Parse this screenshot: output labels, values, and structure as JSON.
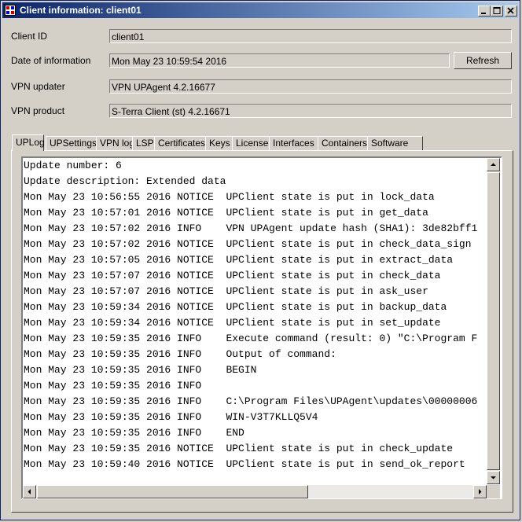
{
  "window": {
    "title": "Client information: client01"
  },
  "fields": [
    {
      "label": "Client ID",
      "value": "client01"
    },
    {
      "label": "Date of information",
      "value": "Mon May 23 10:59:54 2016"
    },
    {
      "label": "VPN updater",
      "value": "VPN UPAgent 4.2.16677"
    },
    {
      "label": "VPN product",
      "value": "S-Terra Client (st) 4.2.16671"
    }
  ],
  "refresh_label": "Refresh",
  "tabs": [
    "UPLog",
    "UPSettings",
    "VPN log",
    "LSP",
    "Certificates",
    "Keys",
    "License",
    "Interfaces",
    "Containers",
    "Software"
  ],
  "active_tab": "UPLog",
  "log_lines": [
    "Update number: 6",
    "Update description: Extended data",
    "Mon May 23 10:56:55 2016 NOTICE  UPClient state is put in lock_data",
    "Mon May 23 10:57:01 2016 NOTICE  UPClient state is put in get_data",
    "Mon May 23 10:57:02 2016 INFO    VPN UPAgent update hash (SHA1): 3de82bff1",
    "Mon May 23 10:57:02 2016 NOTICE  UPClient state is put in check_data_sign",
    "Mon May 23 10:57:05 2016 NOTICE  UPClient state is put in extract_data",
    "Mon May 23 10:57:07 2016 NOTICE  UPClient state is put in check_data",
    "Mon May 23 10:57:07 2016 NOTICE  UPClient state is put in ask_user",
    "Mon May 23 10:59:34 2016 NOTICE  UPClient state is put in backup_data",
    "Mon May 23 10:59:34 2016 NOTICE  UPClient state is put in set_update",
    "Mon May 23 10:59:35 2016 INFO    Execute command (result: 0) \"C:\\Program F",
    "Mon May 23 10:59:35 2016 INFO    Output of command:",
    "Mon May 23 10:59:35 2016 INFO    BEGIN",
    "Mon May 23 10:59:35 2016 INFO",
    "Mon May 23 10:59:35 2016 INFO    C:\\Program Files\\UPAgent\\updates\\00000006",
    "Mon May 23 10:59:35 2016 INFO    WIN-V3T7KLLQ5V4",
    "Mon May 23 10:59:35 2016 INFO    END",
    "Mon May 23 10:59:35 2016 NOTICE  UPClient state is put in check_update",
    "Mon May 23 10:59:40 2016 NOTICE  UPClient state is put in send_ok_report"
  ]
}
